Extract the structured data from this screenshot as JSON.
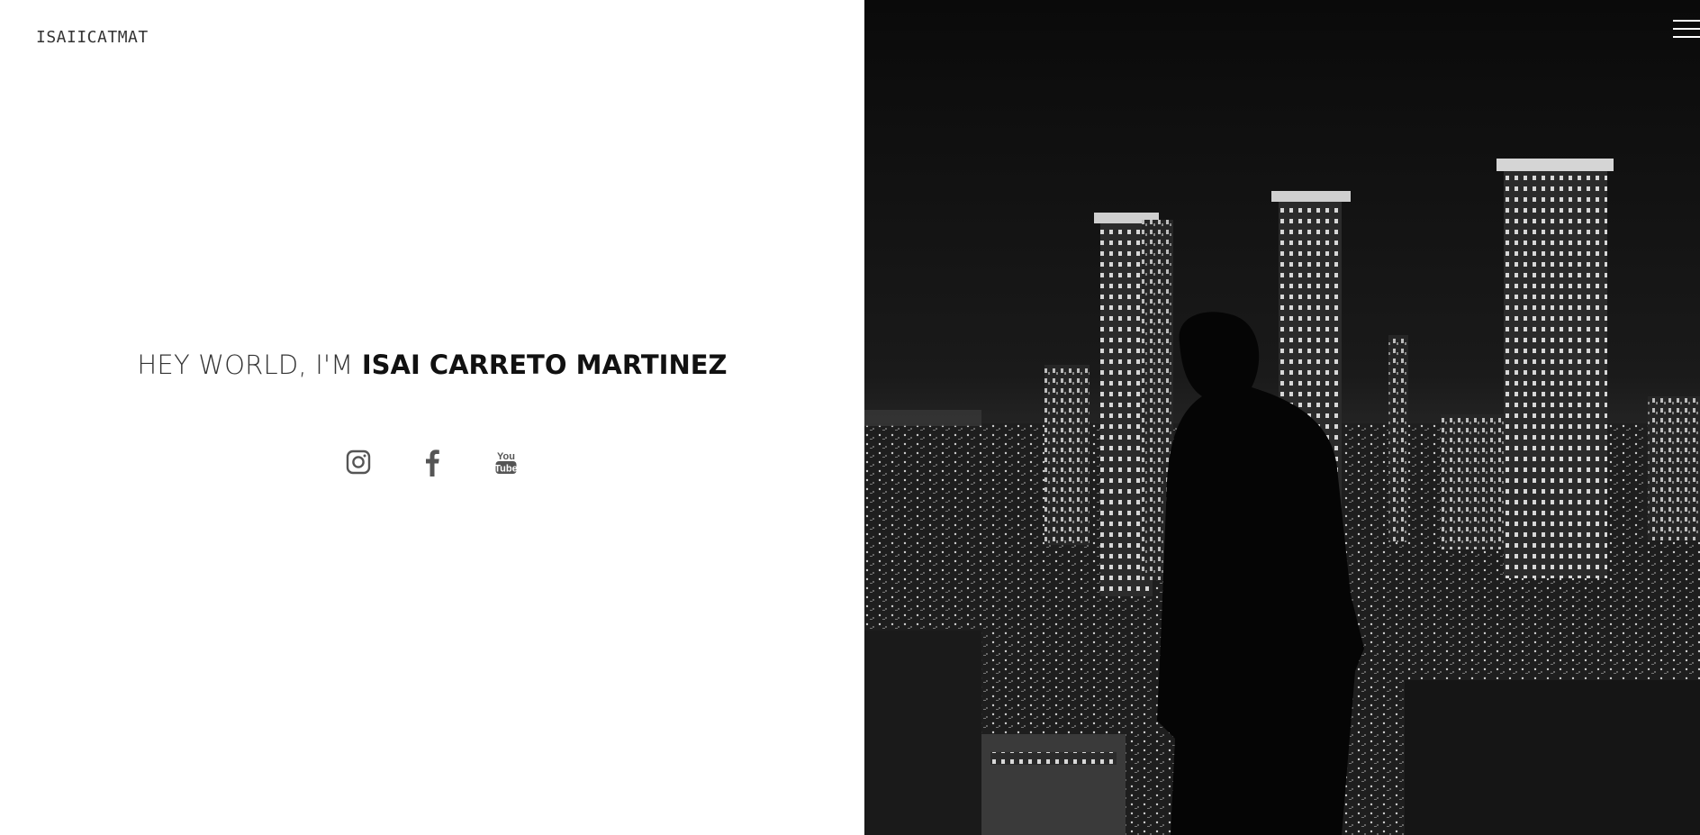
{
  "header": {
    "brand": "ISAIICATMAT"
  },
  "hero": {
    "greeting": "HEY WORLD, I'M ",
    "name": "ISAI CARRETO MARTINEZ"
  },
  "socials": [
    {
      "icon": "instagram-icon"
    },
    {
      "icon": "facebook-icon"
    },
    {
      "icon": "youtube-icon",
      "glyph_top": "You",
      "glyph_bottom": "Tube"
    }
  ],
  "colors": {
    "icon": "#555555",
    "photo_bg": "#0b0b0b",
    "menu": "#ffffff"
  },
  "menu": {
    "icon": "hamburger-menu-icon"
  }
}
